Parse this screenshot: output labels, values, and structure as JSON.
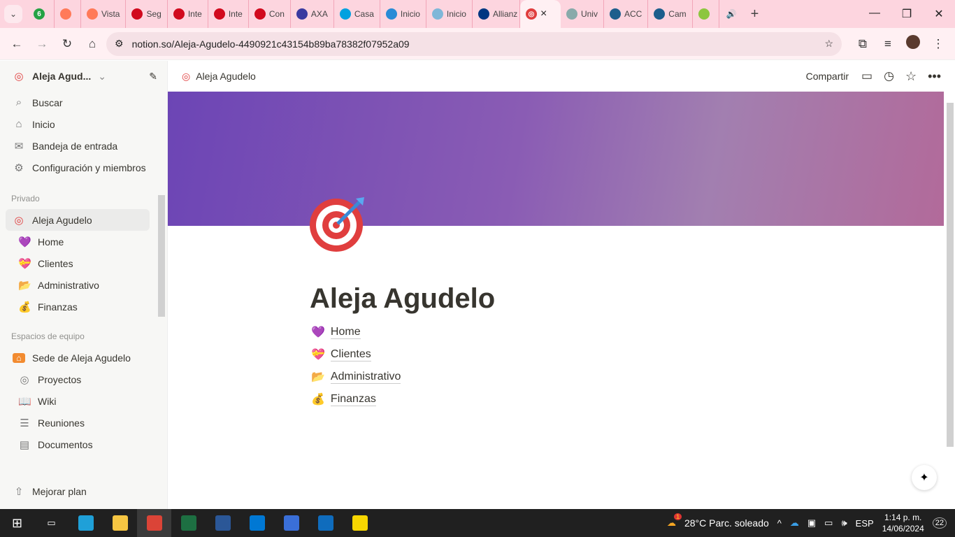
{
  "browser": {
    "tabs": [
      {
        "label": "",
        "color": "#25a244",
        "badge": "6"
      },
      {
        "label": "",
        "color": "#ff7a59"
      },
      {
        "label": "Vista",
        "color": "#ff7a59"
      },
      {
        "label": "Seg",
        "color": "#d10a1e"
      },
      {
        "label": "Inte",
        "color": "#d10a1e"
      },
      {
        "label": "Inte",
        "color": "#d10a1e"
      },
      {
        "label": "Con",
        "color": "#d10a1e"
      },
      {
        "label": "AXA",
        "color": "#3a3aa0"
      },
      {
        "label": "Casa",
        "color": "#00a1e0"
      },
      {
        "label": "Inicio",
        "color": "#2a8bd6"
      },
      {
        "label": "Inicio",
        "color": "#7fb7d8"
      },
      {
        "label": "Allianz",
        "color": "#003781"
      }
    ],
    "active_tab_close": "×",
    "tabs_after": [
      {
        "label": "Univ",
        "color": "#8aa"
      },
      {
        "label": "ACC",
        "color": "#1d5e8c"
      },
      {
        "label": "Cam",
        "color": "#1d5e8c"
      },
      {
        "label": "",
        "color": "#8dc63f"
      }
    ],
    "new_tab": "+",
    "url": "notion.so/Aleja-Agudelo-4490921c43154b89ba78382f07952a09"
  },
  "sidebar": {
    "workspace": "Aleja Agud...",
    "nav": [
      {
        "label": "Buscar",
        "icon": "⌕"
      },
      {
        "label": "Inicio",
        "icon": "⌂"
      },
      {
        "label": "Bandeja de entrada",
        "icon": "✉"
      },
      {
        "label": "Configuración y miembros",
        "icon": "⚙"
      }
    ],
    "private_label": "Privado",
    "private_root": "Aleja Agudelo",
    "private_items": [
      {
        "label": "Home",
        "icon": "💜"
      },
      {
        "label": "Clientes",
        "icon": "💝"
      },
      {
        "label": "Administrativo",
        "icon": "📂"
      },
      {
        "label": "Finanzas",
        "icon": "💰"
      }
    ],
    "teams_label": "Espacios de equipo",
    "team_root": "Sede de Aleja Agudelo",
    "team_items": [
      {
        "label": "Proyectos",
        "icon": "◎"
      },
      {
        "label": "Wiki",
        "icon": "📖"
      },
      {
        "label": "Reuniones",
        "icon": "☰"
      },
      {
        "label": "Documentos",
        "icon": "▤"
      }
    ],
    "upgrade": "Mejorar plan"
  },
  "page": {
    "breadcrumb": "Aleja Agudelo",
    "share": "Compartir",
    "title": "Aleja Agudelo",
    "links": [
      {
        "label": "Home",
        "icon": "💜"
      },
      {
        "label": "Clientes",
        "icon": "💝"
      },
      {
        "label": "Administrativo",
        "icon": "📂"
      },
      {
        "label": "Finanzas",
        "icon": "💰"
      }
    ]
  },
  "taskbar": {
    "weather": "28°C  Parc. soleado",
    "weather_badge": "1",
    "lang": "ESP",
    "time": "1:14 p. m.",
    "date": "14/06/2024",
    "notifications": "22",
    "apps": [
      {
        "name": "edge",
        "color": "#1fa0d8"
      },
      {
        "name": "explorer",
        "color": "#f5c542"
      },
      {
        "name": "chrome",
        "color": "#db4437"
      },
      {
        "name": "excel",
        "color": "#1d6f42"
      },
      {
        "name": "word",
        "color": "#2b5797"
      },
      {
        "name": "azure-devops",
        "color": "#0078d4"
      },
      {
        "name": "remote",
        "color": "#3a6fd8"
      },
      {
        "name": "outlook",
        "color": "#0f6cbd"
      },
      {
        "name": "sticky-notes",
        "color": "#f7d600"
      }
    ]
  }
}
